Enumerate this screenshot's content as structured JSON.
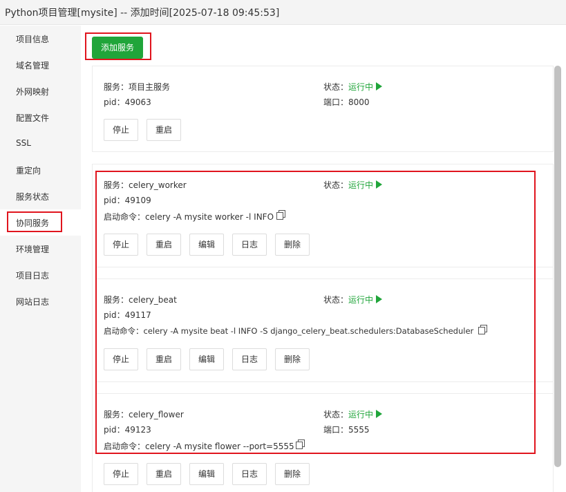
{
  "window": {
    "title": "Python项目管理[mysite] -- 添加时间[2025-07-18 09:45:53]"
  },
  "sidebar": {
    "items": [
      {
        "label": "项目信息"
      },
      {
        "label": "域名管理"
      },
      {
        "label": "外网映射"
      },
      {
        "label": "配置文件"
      },
      {
        "label": "SSL"
      },
      {
        "label": "重定向"
      },
      {
        "label": "服务状态"
      },
      {
        "label": "协同服务",
        "active": true
      },
      {
        "label": "环境管理"
      },
      {
        "label": "项目日志"
      },
      {
        "label": "网站日志"
      }
    ]
  },
  "toolbar": {
    "add_service_label": "添加服务"
  },
  "labels": {
    "service": "服务：",
    "pid": "pid：",
    "status": "状态：",
    "port": "端口：",
    "command": "启动命令：",
    "stop": "停止",
    "restart": "重启",
    "edit": "编辑",
    "log": "日志",
    "delete": "删除"
  },
  "services": [
    {
      "name": "项目主服务",
      "pid": "49063",
      "status": "运行中",
      "port": "8000"
    },
    {
      "name": "celery_worker",
      "pid": "49109",
      "status": "运行中",
      "command": "celery -A mysite worker -l INFO"
    },
    {
      "name": "celery_beat",
      "pid": "49117",
      "status": "运行中",
      "command": "celery -A mysite beat -l INFO -S django_celery_beat.schedulers:DatabaseScheduler"
    },
    {
      "name": "celery_flower",
      "pid": "49123",
      "status": "运行中",
      "port": "5555",
      "command": "celery -A mysite flower --port=5555"
    }
  ],
  "colors": {
    "accent": "#20a53a",
    "highlight": "#e0141d"
  }
}
